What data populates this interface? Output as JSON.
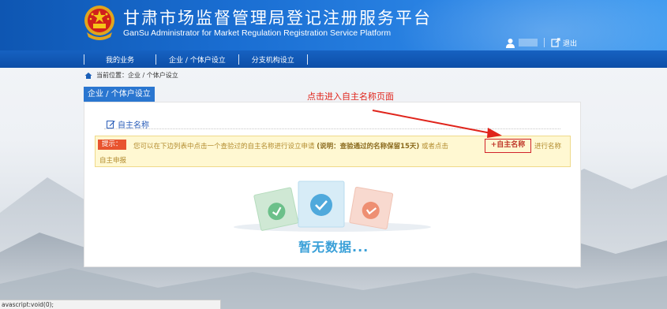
{
  "header": {
    "title_cn": "甘肃市场监督管理局登记注册服务平台",
    "title_en": "GanSu Administrator for Market Regulation Registration Service Platform",
    "logout_label": "退出"
  },
  "nav": {
    "items": [
      "我的业务",
      "企业 / 个体户设立",
      "分支机构设立"
    ]
  },
  "breadcrumb": {
    "text": "当前位置：企业 / 个体户设立"
  },
  "main": {
    "tab_label": "企业 / 个体户设立",
    "annotation": "点击进入自主名称页面",
    "section_title": "自主名称",
    "tip": {
      "badge": "提示：",
      "text_before": "您可以在下边列表中点击一个查验过的自主名称进行设立申请",
      "text_bold": "(说明：查验通过的名称保留15天)",
      "text_mid": "或者点击",
      "button_label": "+自主名称",
      "text_after": "进行名称",
      "text_line2": "自主申报"
    },
    "empty_label": "暂无数据..."
  },
  "statusbar": {
    "text": "avascript:void(0);"
  },
  "colors": {
    "header_blue": "#1a6ed2",
    "nav_blue": "#0d4fa8",
    "accent_red": "#d2232a",
    "tip_bg": "#fff8d2"
  }
}
